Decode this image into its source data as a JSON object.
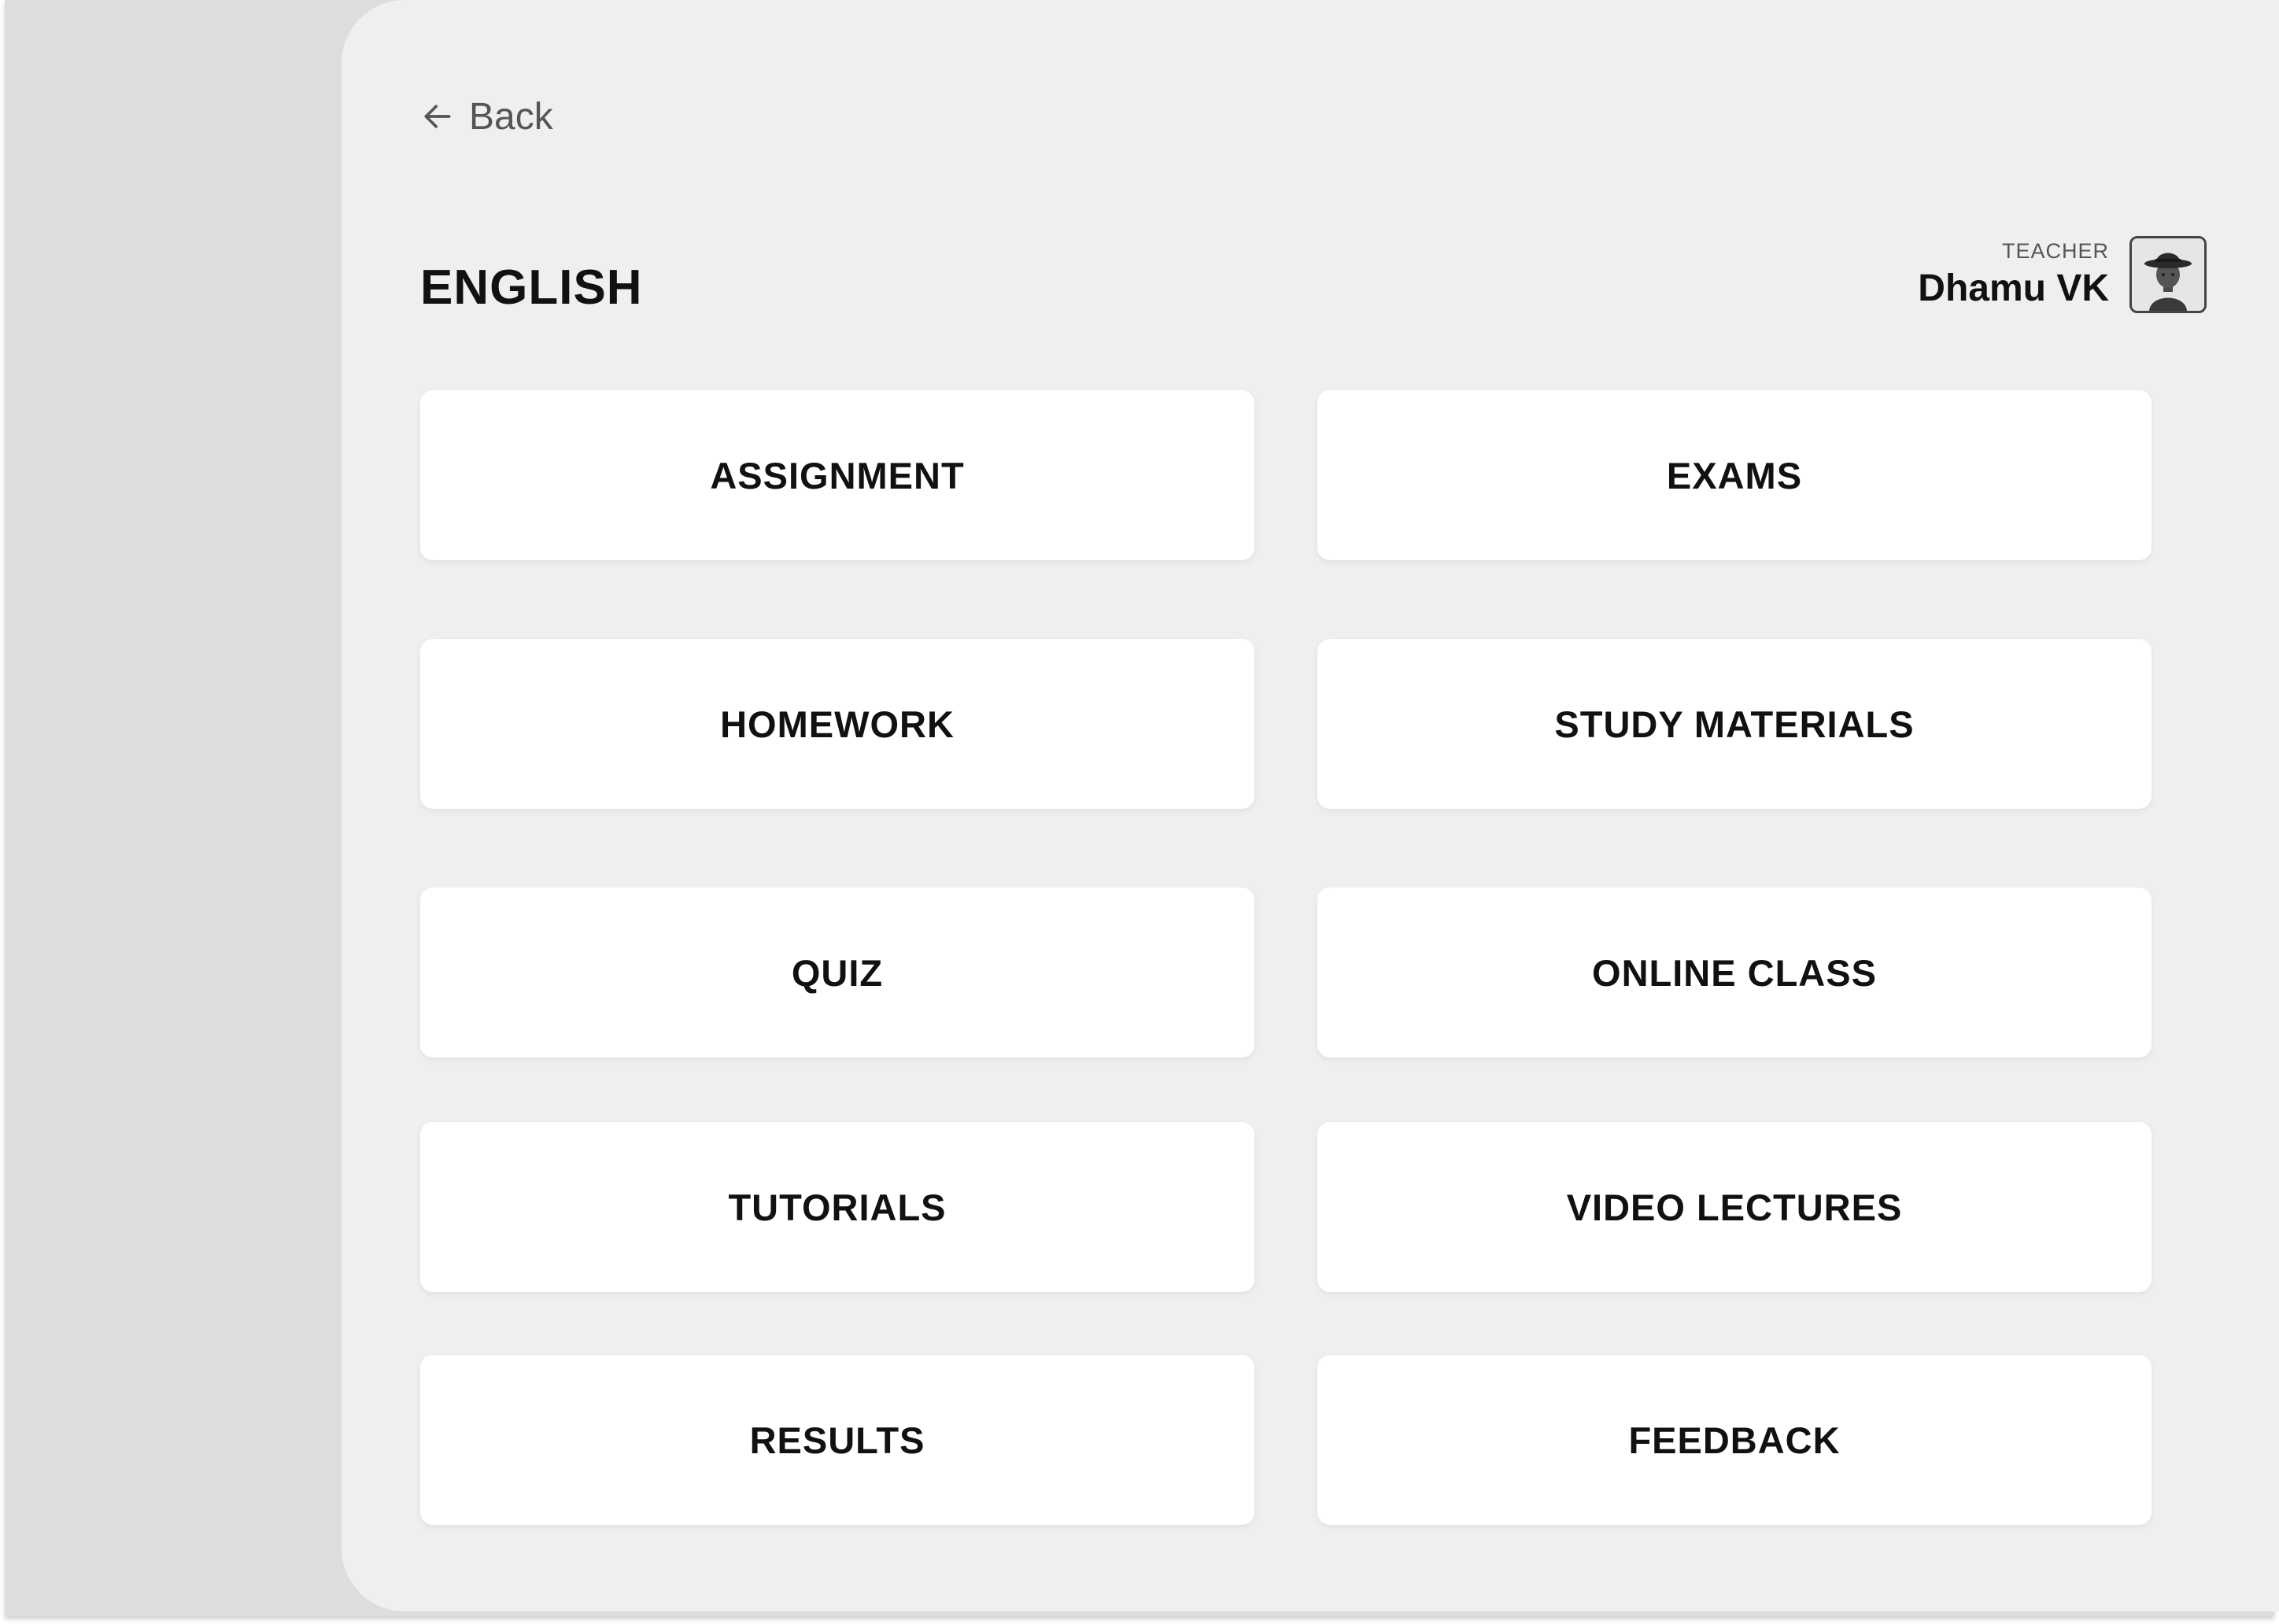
{
  "nav": {
    "back_label": "Back",
    "back_icon": "arrow-left-icon"
  },
  "subject": {
    "title": "ENGLISH"
  },
  "teacher": {
    "role": "TEACHER",
    "name": "Dhamu VK",
    "avatar_icon": "avatar-cowboy-hat"
  },
  "menu": {
    "items": [
      {
        "label": "ASSIGNMENT"
      },
      {
        "label": "EXAMS"
      },
      {
        "label": "HOMEWORK"
      },
      {
        "label": "STUDY MATERIALS"
      },
      {
        "label": "QUIZ"
      },
      {
        "label": "ONLINE CLASS"
      },
      {
        "label": "TUTORIALS"
      },
      {
        "label": "VIDEO LECTURES"
      },
      {
        "label": "RESULTS"
      },
      {
        "label": "FEEDBACK"
      }
    ]
  },
  "colors": {
    "page_background": "#efefef",
    "sidebar_background": "#dddddd",
    "card_background": "#ffffff",
    "text_primary": "#111111",
    "text_secondary": "#555555"
  }
}
